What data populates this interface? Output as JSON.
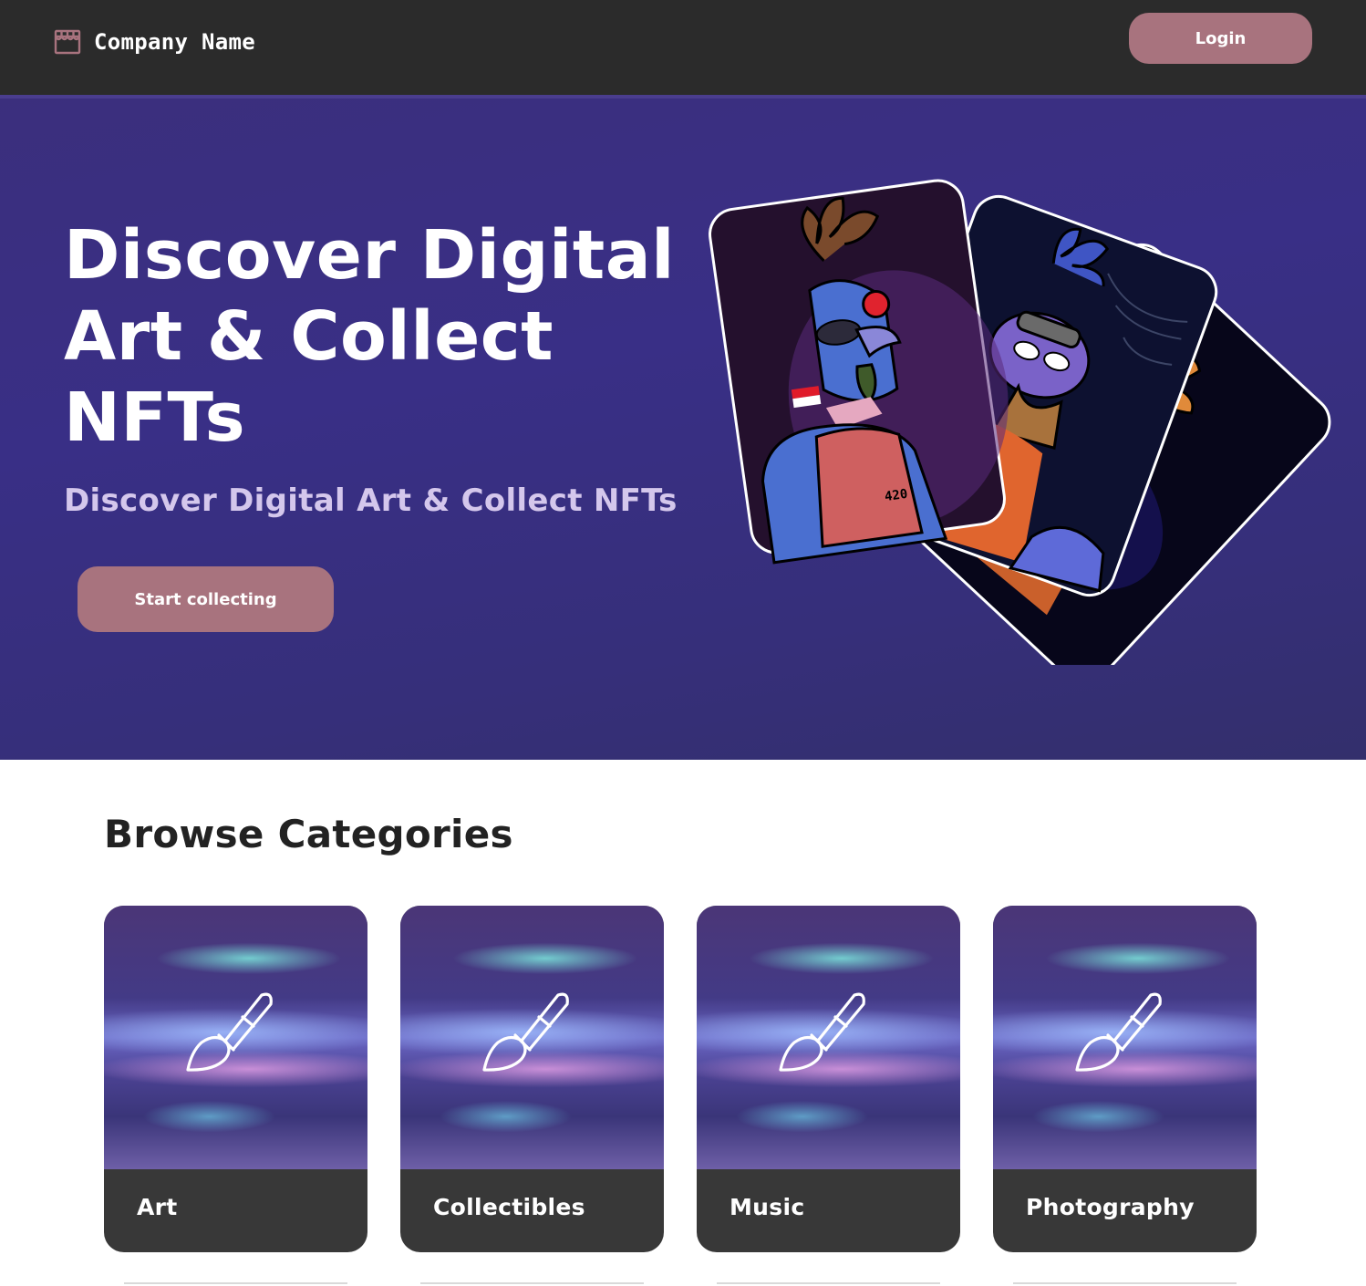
{
  "header": {
    "brand_name": "Company Name",
    "brand_icon": "storefront-icon",
    "login_label": "Login"
  },
  "hero": {
    "title": "Discover Digital Art & Collect NFTs",
    "subtitle": "Discover Digital Art & Collect NFTs",
    "cta_label": "Start collecting",
    "card_number": "420"
  },
  "categories": {
    "heading": "Browse Categories",
    "items": [
      {
        "label": "Art",
        "icon": "paintbrush-icon"
      },
      {
        "label": "Collectibles",
        "icon": "paintbrush-icon"
      },
      {
        "label": "Music",
        "icon": "paintbrush-icon"
      },
      {
        "label": "Photography",
        "icon": "paintbrush-icon"
      }
    ]
  },
  "colors": {
    "header_bg": "#2b2b2b",
    "accent_button": "#a8737e",
    "hero_bg": "#392f86",
    "card_footer": "#383838"
  }
}
